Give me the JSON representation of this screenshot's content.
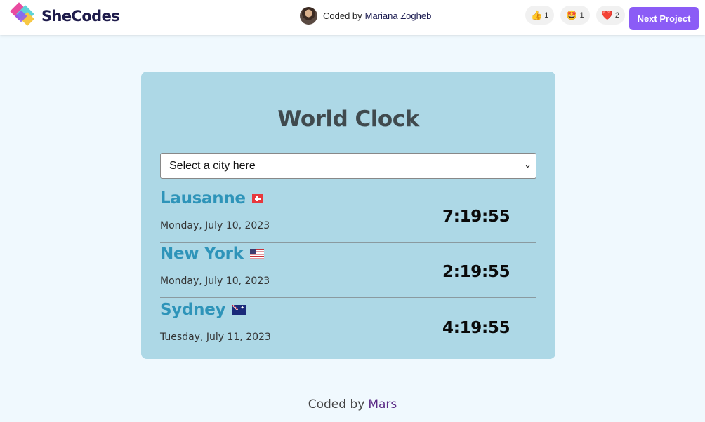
{
  "topbar": {
    "brand": "SheCodes",
    "author_prefix": "Coded by",
    "author_name": "Mariana Zogheb",
    "reactions": [
      {
        "icon": "thumbs-up-icon",
        "emoji": "👍",
        "count": "1"
      },
      {
        "icon": "star-struck-icon",
        "emoji": "🤩",
        "count": "1"
      },
      {
        "icon": "heart-icon",
        "emoji": "❤️",
        "count": "2"
      }
    ],
    "next_button": "Next Project"
  },
  "card": {
    "title": "World Clock",
    "select": {
      "selected": "Select a city here"
    },
    "cities": [
      {
        "name": "Lausanne",
        "flag": "switzerland-flag",
        "date": "Monday, July 10, 2023",
        "time": "7:19:55"
      },
      {
        "name": "New York",
        "flag": "usa-flag",
        "date": "Monday, July 10, 2023",
        "time": "2:19:55"
      },
      {
        "name": "Sydney",
        "flag": "australia-flag",
        "date": "Tuesday, July 11, 2023",
        "time": "4:19:55"
      }
    ]
  },
  "footer": {
    "prefix": "Coded by",
    "link": "Mars"
  },
  "colors": {
    "page_bg": "#f0f9fe",
    "card_bg": "#add8e6",
    "city_name": "#2e94b9",
    "accent_button": "#8b5cf6",
    "footer_link": "#5b2a86"
  }
}
